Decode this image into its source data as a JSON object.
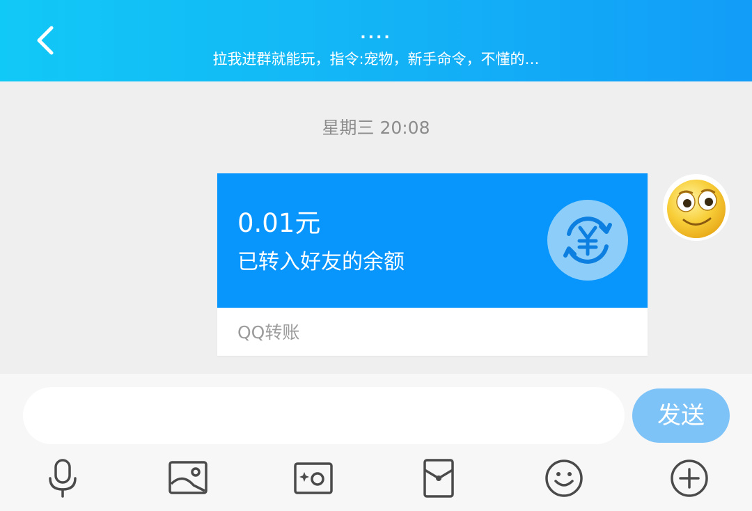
{
  "header": {
    "title": "....",
    "subtitle": "拉我进群就能玩，指令:宠物，新手命令，不懂的…"
  },
  "chat": {
    "timestamp": "星期三 20:08",
    "transfer": {
      "amount": "0.01元",
      "description": "已转入好友的余额",
      "footer": "QQ转账"
    }
  },
  "input": {
    "placeholder": "",
    "send_label": "发送"
  },
  "toolbar": {
    "items": [
      "mic-icon",
      "image-icon",
      "camera-icon",
      "red-packet-icon",
      "emoji-icon",
      "plus-icon"
    ]
  },
  "colors": {
    "header_gradient_start": "#11c9f7",
    "header_gradient_end": "#129df8",
    "transfer_card": "#0895fc",
    "send_button": "#7ec3f7"
  }
}
